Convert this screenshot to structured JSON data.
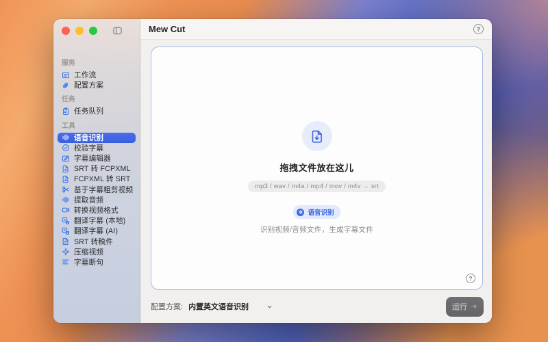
{
  "titlebar": {
    "app_title": "Mew Cut",
    "help_glyph": "?"
  },
  "sidebar": {
    "sections": [
      {
        "header": "服务",
        "items": [
          {
            "label": "工作流",
            "icon": "workflow-icon"
          },
          {
            "label": "配置方案",
            "icon": "paperclip-icon"
          }
        ]
      },
      {
        "header": "任务",
        "items": [
          {
            "label": "任务队列",
            "icon": "clipboard-icon"
          }
        ]
      },
      {
        "header": "工具",
        "items": [
          {
            "label": "语音识别",
            "icon": "waveform-icon",
            "selected": true
          },
          {
            "label": "校验字幕",
            "icon": "check-circle-icon"
          },
          {
            "label": "字幕编辑器",
            "icon": "subtitle-editor-icon"
          },
          {
            "label": "SRT 转 FCPXML",
            "icon": "doc-convert-icon"
          },
          {
            "label": "FCPXML 转 SRT",
            "icon": "doc-convert-icon"
          },
          {
            "label": "基于字幕粗剪视频",
            "icon": "scissors-icon"
          },
          {
            "label": "提取音频",
            "icon": "waveform-icon"
          },
          {
            "label": "转换视频格式",
            "icon": "video-camera-icon"
          },
          {
            "label": "翻译字幕 (本地)",
            "icon": "translate-icon"
          },
          {
            "label": "翻译字幕 (AI)",
            "icon": "translate-icon"
          },
          {
            "label": "SRT 转稿件",
            "icon": "document-icon"
          },
          {
            "label": "压缩视频",
            "icon": "compress-icon"
          },
          {
            "label": "字幕断句",
            "icon": "segment-lines-icon"
          }
        ]
      }
    ]
  },
  "dropzone": {
    "title": "拖拽文件放在这儿",
    "formats": "mp3 / wav / m4a / mp4 / mov / m4v → srt",
    "badge": {
      "label": "语音识别",
      "icon": "gear-icon"
    },
    "caption": "识别视频/音频文件，生成字幕文件",
    "help_glyph": "?"
  },
  "footer": {
    "config_label": "配置方案:",
    "config_value": "内置英文语音识别",
    "run_label": "运行",
    "run_arrow": "→"
  },
  "colors": {
    "accent": "#3a66e5",
    "sidebar_selected": "#3c64e4",
    "icon_blue": "#3573f0",
    "run_button_bg": "#69696d",
    "dropzone_border": "#a8b9e8",
    "badge_bg": "#e3eafb"
  }
}
